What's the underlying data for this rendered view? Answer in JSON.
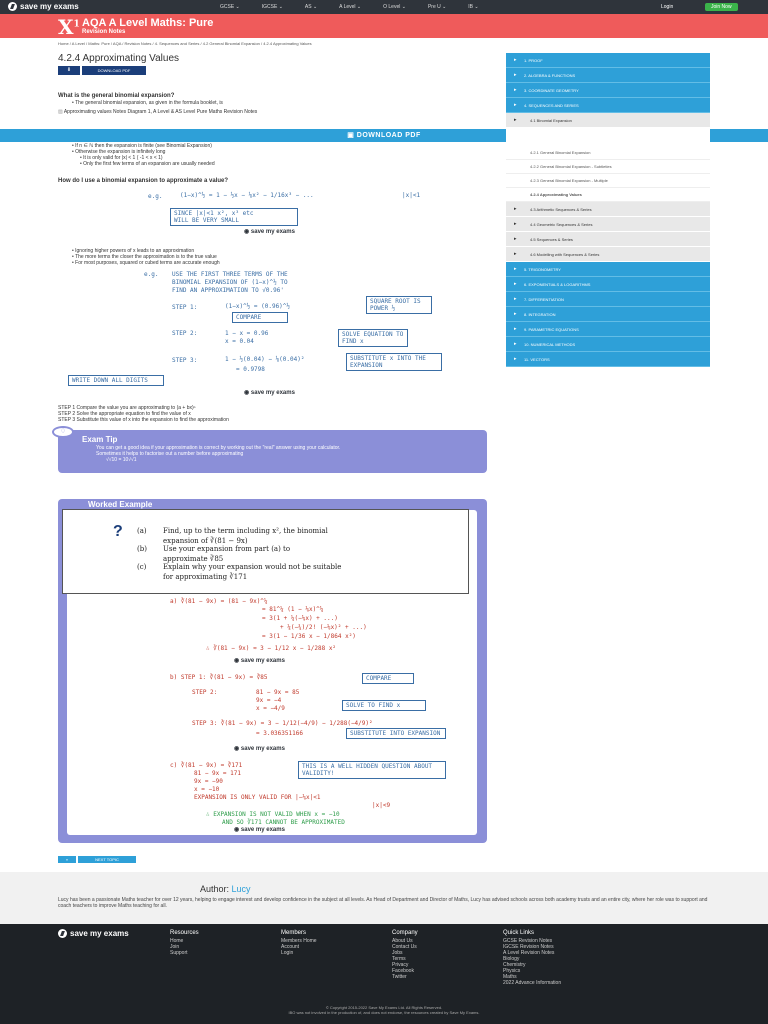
{
  "topnav": {
    "logo_text": "save my exams",
    "links": [
      "GCSE ⌄",
      "IGCSE ⌄",
      "AS ⌄",
      "A Level ⌄",
      "O Level ⌄",
      "Pre U ⌄",
      "IB ⌄"
    ],
    "login": "Login",
    "join": "Join Now"
  },
  "banner": {
    "mark": "X",
    "sup": "1",
    "title": "AQA A Level Maths: Pure",
    "subtitle": "Revision Notes"
  },
  "breadcrumb": "Home / A Level / Maths: Pure / AQA / Revision Notes / 4. Sequences and Series / 4.2 General Binomial Expansion / 4.2.4 Approximating Values",
  "page": {
    "title": "4.2.4 Approximating Values",
    "download_pdf_small": "DOWNLOAD PDF",
    "download_bar": "DOWNLOAD PDF",
    "h_general": "What is the general binomial expansion?",
    "general_bullet": "The general binomial expansion, as given in the formula booklet, is",
    "image_caption": "Approximating values Notes Diagram 1, A Level & AS Level Pure Maths Revision Notes",
    "bullets_a": [
      "If n ∈ ℕ then the expansion is finite (see Binomial Expansion)",
      "Otherwise the expansion is infinitely long",
      "It is only valid for |x| < 1 ( -1 < x < 1)",
      "Only the first few terms of an expansion are usually needed"
    ],
    "h_how": "How do I use a binomial expansion to approximate a value?",
    "bullets_b": [
      "Ignoring higher powers of x leads to an approximation",
      "The more terms the closer the approximation is to the true value",
      "For most purposes, squared or cubed terms are accurate enough"
    ],
    "steps": [
      "STEP 1  Compare the value you are approximating to (a + bx)ⁿ",
      "STEP 2  Solve the appropriate equation to find the value of x",
      "STEP 3  Substitute this value of x into the expansion to find the approximation"
    ]
  },
  "hw": {
    "eg": "e.g.",
    "expansion": "(1−x)^½ = 1 − ½x − ⅛x² − 1/16x³ − ...",
    "validity": "|x|<1",
    "small_note_1": "SINCE |x|<1 x², x³ etc",
    "small_note_2": "WILL BE VERY SMALL",
    "task_1": "USE THE FIRST THREE TERMS OF THE",
    "task_2": "BINOMIAL EXPANSION OF (1−x)^½ TO",
    "task_3": "FIND AN APPROXIMATION TO √0.96'",
    "step1_label": "STEP 1:",
    "step1_expr": "(1−x)^½ = (0.96)^½",
    "compare": "COMPARE",
    "square_root": "SQUARE ROOT IS POWER ½",
    "step2_label": "STEP 2:",
    "step2_eq": "1 − x = 0.96",
    "step2_res": "x = 0.04",
    "solve_eq": "SOLVE EQUATION TO FIND x",
    "step3_label": "STEP 3:",
    "step3_expr": "1 − ½(0.04) − ⅛(0.04)²",
    "step3_res": "= 0.9798",
    "substitute": "SUBSTITUTE x INTO THE EXPANSION",
    "write_digits": "WRITE DOWN ALL DIGITS",
    "sme": "save my exams"
  },
  "examtip": {
    "title": "Exam Tip",
    "lines": [
      "You can get a good idea if your approximation is correct by working out the \"real\" answer using your calculator.",
      "Sometimes it helps to factorise out a number before approximating",
      "√√10 = 10√√1"
    ]
  },
  "worked": {
    "title": "Worked Example",
    "qa_label": "(a)",
    "qa_1": "Find, up to the term including x², the binomial",
    "qa_2": "expansion of ∛(81 − 9x)",
    "qb_label": "(b)",
    "qb_1": "Use your expansion from part (a) to",
    "qb_2": "approximate ∛85",
    "qc_label": "(c)",
    "qc_1": "Explain why your expansion would not be suitable",
    "qc_2": "for approximating ∛171",
    "a_lines": [
      "a)    ∛(81 − 9x) = (81 − 9x)^¼",
      "= 81^¼ (1 − ⅑x)^¼",
      "= 3(1 + ¼(−⅑x) + ...)",
      "+ ¼(−¾)/2! (−⅑x)² + ...)",
      "= 3(1 − 1/36 x − 1/864 x²)",
      "∴  ∛(81 − 9x) ≈ 3 − 1/12 x − 1/288 x²"
    ],
    "b_step1": "b)    STEP 1:    ∛(81 − 9x) = ∛85",
    "b_compare": "COMPARE",
    "b_step2": "STEP 2:",
    "b_eq": [
      "81 − 9x = 85",
      "9x = −4",
      "x = −4/9"
    ],
    "b_solve": "SOLVE TO FIND x",
    "b_step3": "STEP 3:    ∛(81 − 9x) = 3 − 1/12(−4/9) − 1/288(−4/9)²",
    "b_res": "= 3.036351166",
    "b_sub": "SUBSTITUTE INTO EXPANSION",
    "c_lines": [
      "c)    ∛(81 − 9x) = ∛171",
      "81 − 9x = 171",
      "9x = −90",
      "x = −10"
    ],
    "c_note": "THIS IS A WELL HIDDEN QUESTION ABOUT VALIDITY!",
    "c_valid": "EXPANSION IS ONLY VALID FOR |−⅑x|<1",
    "c_valid2": "|x|<9",
    "c_concl_1": "∴  EXPANSION IS NOT VALID WHEN x = −10",
    "c_concl_2": "AND SO ∛171 CANNOT BE APPROXIMATED"
  },
  "pager": {
    "prev": "«",
    "next": "NEXT TOPIC"
  },
  "sidebar": {
    "items": [
      "1. PROOF",
      "2. ALGEBRA & FUNCTIONS",
      "3. COORDINATE GEOMETRY",
      "4. SEQUENCES AND SERIES"
    ],
    "sub_active": "4.1 Binomial Expansion",
    "subsub": [
      "4.2.1 General Binomial Expansion",
      "4.2.2 General Binomial Expansion - Subtleties",
      "4.2.3 General Binomial Expansion - Multiple",
      "4.2.4 Approximating Values"
    ],
    "subs": [
      "4.3 Arithmetic Sequences & Series",
      "4.4 Geometric Sequences & Series",
      "4.5 Sequences & Series",
      "4.6 Modelling with Sequences & Series"
    ],
    "items2": [
      "5. TRIGONOMETRY",
      "6. EXPONENTIALS & LOGARITHMS",
      "7. DIFFERENTIATION",
      "8. INTEGRATION",
      "9. PARAMETRIC EQUATIONS",
      "10. NUMERICAL METHODS",
      "11. VECTORS"
    ]
  },
  "author": {
    "label": "Author:",
    "name": "Lucy",
    "bio": "Lucy has been a passionate Maths teacher for over 12 years, helping to engage interest and develop confidence in the subject at all levels. As Head of Department and Director of Maths, Lucy has advised schools across both academy trusts and an entire city, where her role was to support and coach teachers to improve Maths teaching for all."
  },
  "footer": {
    "logo": "save my exams",
    "resources": {
      "h": "Resources",
      "items": [
        "Home",
        "Join",
        "Support"
      ]
    },
    "members": {
      "h": "Members",
      "items": [
        "Members Home",
        "Account",
        "Login"
      ]
    },
    "company": {
      "h": "Company",
      "items": [
        "About Us",
        "Contact Us",
        "Jobs",
        "Terms",
        "Privacy",
        "Facebook",
        "Twitter"
      ]
    },
    "quick": {
      "h": "Quick Links",
      "items": [
        "GCSE Revision Notes",
        "IGCSE Revision Notes",
        "A Level Revision Notes",
        "Biology",
        "Chemistry",
        "Physics",
        "Maths",
        "2022 Advance Information"
      ]
    },
    "copy1": "© Copyright 2015-2022 Save My Exams Ltd. All Rights Reserved.",
    "copy2": "IBO was not involved in the production of, and does not endorse, the resources created by Save My Exams."
  },
  "colors": {
    "nav": "#2f343b",
    "banner": "#ef5b5b",
    "accent": "#2ea0d8",
    "tip": "#8b8fd8",
    "join": "#3bb34a",
    "hw_blue": "#3a6ea5",
    "hw_red": "#c0392b"
  }
}
